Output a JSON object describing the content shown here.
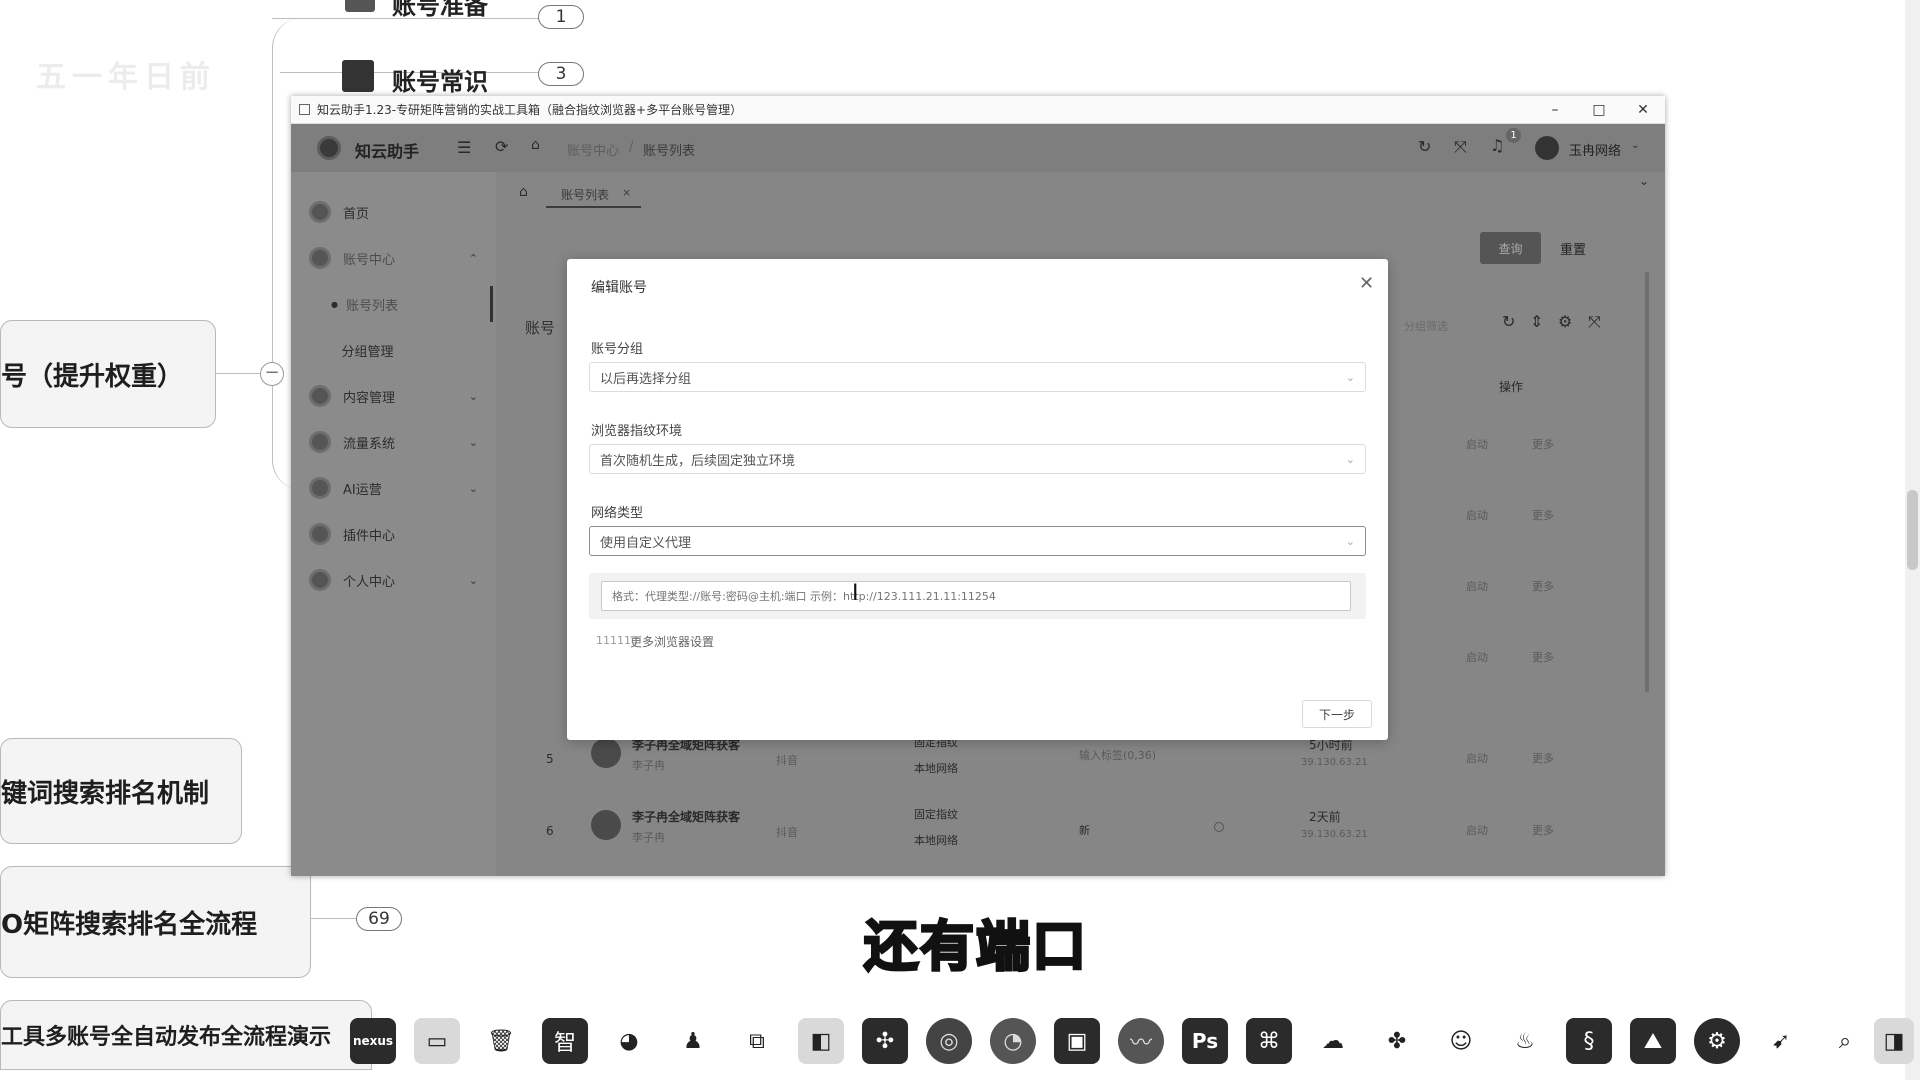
{
  "mindmap": {
    "top_node": "账号准备",
    "node_account": "账号常识",
    "node_left_middle": "号（提升权重）",
    "node_keyword": "键词搜索排名机制",
    "node_process": "O矩阵搜索排名全流程",
    "node_tool": "工具多账号全自动发布全流程演示",
    "pill_1": "1",
    "pill_3": "3",
    "pill_69": "69",
    "faint_text": "五一年日前"
  },
  "window": {
    "title": "知云助手1.23-专研矩阵营销的实战工具箱（融合指纹浏览器+多平台账号管理）",
    "minimize": "–",
    "maximize": "□",
    "close": "✕"
  },
  "header": {
    "app_name": "知云助手",
    "breadcrumb_1": "账号中心",
    "breadcrumb_sep": "/",
    "breadcrumb_2": "账号列表",
    "user_name": "玉冉网络",
    "notif_count": "1"
  },
  "tabs": {
    "active_tab": "账号列表"
  },
  "sidebar": {
    "items": [
      {
        "label": "首页"
      },
      {
        "label": "账号中心"
      },
      {
        "label": "账号列表"
      },
      {
        "label": "分组管理"
      },
      {
        "label": "内容管理"
      },
      {
        "label": "流量系统"
      },
      {
        "label": "AI运营"
      },
      {
        "label": "插件中心"
      },
      {
        "label": "个人中心"
      }
    ]
  },
  "content": {
    "query_btn": "查询",
    "reset_btn": "重置",
    "section_label": "账号",
    "column_ops": "操作",
    "filter_label": "分组筛选",
    "rows": [
      {
        "start": "启动",
        "more": "更多"
      },
      {
        "start": "启动",
        "more": "更多"
      },
      {
        "start": "启动",
        "more": "更多"
      },
      {
        "start": "启动",
        "more": "更多"
      },
      {
        "index": "5",
        "name": "李子冉全域矩阵获客",
        "sub": "李子冉",
        "platform": "抖音",
        "type": "固定指纹",
        "net": "本地网络",
        "info": "输入标签(0,36)",
        "time": "5小时前",
        "ip": "39.130.63.21",
        "start": "启动",
        "more": "更多"
      },
      {
        "index": "6",
        "name": "李子冉全域矩阵获客",
        "sub": "李子冉",
        "platform": "抖音",
        "type": "固定指纹",
        "net": "本地网络",
        "info": "新",
        "time": "2天前",
        "ip": "39.130.63.21",
        "start": "启动",
        "more": "更多"
      }
    ]
  },
  "modal": {
    "title": "编辑账号",
    "group_label": "账号分组",
    "group_value": "以后再选择分组",
    "env_label": "浏览器指纹环境",
    "env_value": "首次随机生成，后续固定独立环境",
    "net_label": "网络类型",
    "net_value": "使用自定义代理",
    "proxy_placeholder": "格式：代理类型://账号:密码@主机:端口 示例：http://123.111.21.11:11254",
    "more_settings": "更多浏览器设置",
    "more_prefix": "11111",
    "next_btn": "下一步"
  },
  "subtitle": "还有端口",
  "taskbar": {
    "items": [
      "nexus",
      "folder",
      "recycle",
      "zhi",
      "wechat",
      "qq",
      "copy",
      "layout",
      "link",
      "chrome",
      "edge",
      "box",
      "chart",
      "Ps",
      "capcut",
      "cloud",
      "baidu",
      "avatar",
      "flame",
      "steam-like",
      "mountain",
      "steam",
      "pin",
      "search",
      "split"
    ]
  }
}
